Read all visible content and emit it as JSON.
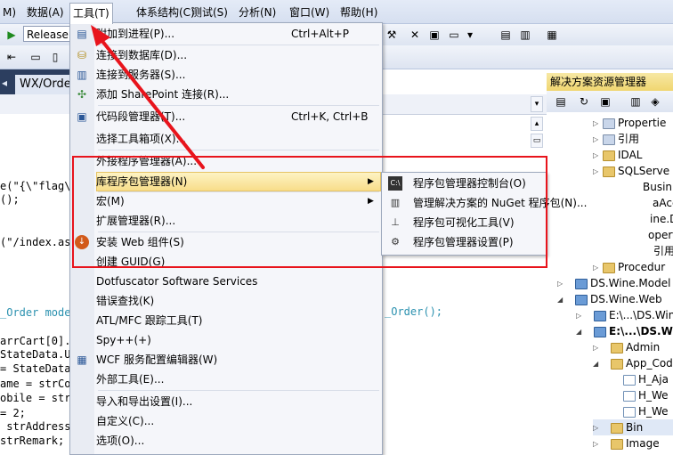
{
  "menubar": {
    "items": [
      {
        "label": "M)"
      },
      {
        "label": "数据(A)"
      },
      {
        "label": "工具(T)"
      },
      {
        "label": "体系结构(C)"
      },
      {
        "label": "测试(S)"
      },
      {
        "label": "分析(N)"
      },
      {
        "label": "窗口(W)"
      },
      {
        "label": "帮助(H)"
      }
    ]
  },
  "toolbar": {
    "config_value": "Release"
  },
  "editor": {
    "tab_label": "WX/Orde",
    "code_lines": [
      "e(\"{\\\"flag\\",
      "();",
      "(\"/index.as",
      "_Order mode",
      "arrCart[0].",
      "StateData.U",
      "= StateData",
      "ame = strCor",
      "obile = strC",
      "= 2;",
      " strAddress;",
      "strRemark;"
    ],
    "right_code": "_Order();"
  },
  "tools_menu": {
    "items": [
      {
        "label": "附加到进程(P)...",
        "shortcut": "Ctrl+Alt+P"
      },
      {
        "label": "连接到数据库(D)..."
      },
      {
        "label": "连接到服务器(S)..."
      },
      {
        "label": "添加 SharePoint 连接(R)..."
      },
      {
        "label": "代码段管理器(T)...",
        "shortcut": "Ctrl+K, Ctrl+B"
      },
      {
        "label": "选择工具箱项(X)..."
      },
      {
        "label": "外接程序管理器(A)..."
      },
      {
        "label": "库程序包管理器(N)"
      },
      {
        "label": "宏(M)"
      },
      {
        "label": "扩展管理器(R)..."
      },
      {
        "label": "安装 Web 组件(S)"
      },
      {
        "label": "创建 GUID(G)"
      },
      {
        "label": "Dotfuscator Software Services"
      },
      {
        "label": "错误查找(K)"
      },
      {
        "label": "ATL/MFC 跟踪工具(T)"
      },
      {
        "label": "Spy++(+)"
      },
      {
        "label": "WCF 服务配置编辑器(W)"
      },
      {
        "label": "外部工具(E)..."
      },
      {
        "label": "导入和导出设置(I)..."
      },
      {
        "label": "自定义(C)..."
      },
      {
        "label": "选项(O)..."
      }
    ]
  },
  "package_submenu": {
    "items": [
      {
        "label": "程序包管理器控制台(O)"
      },
      {
        "label": "管理解决方案的 NuGet 程序包(N)..."
      },
      {
        "label": "程序包可视化工具(V)"
      },
      {
        "label": "程序包管理器设置(P)"
      }
    ]
  },
  "solution_explorer": {
    "title": "解决方案资源管理器",
    "items": [
      {
        "label": "Propertie"
      },
      {
        "label": "引用"
      },
      {
        "label": "IDAL"
      },
      {
        "label": "SQLServe"
      },
      {
        "label": "Busin"
      },
      {
        "label": "aAcce"
      },
      {
        "label": "ine.Dat"
      },
      {
        "label": "opertie"
      },
      {
        "label": "引用"
      },
      {
        "label": "Procedur"
      },
      {
        "label": "DS.Wine.Model"
      },
      {
        "label": "DS.Wine.Web"
      },
      {
        "label": "E:\\...\\DS.Win"
      },
      {
        "label": "E:\\...\\DS.Wi"
      },
      {
        "label": "Admin"
      },
      {
        "label": "App_Cod"
      },
      {
        "label": "H_Aja"
      },
      {
        "label": "H_We"
      },
      {
        "label": "H_We"
      },
      {
        "label": "Bin"
      },
      {
        "label": "Image"
      }
    ]
  }
}
